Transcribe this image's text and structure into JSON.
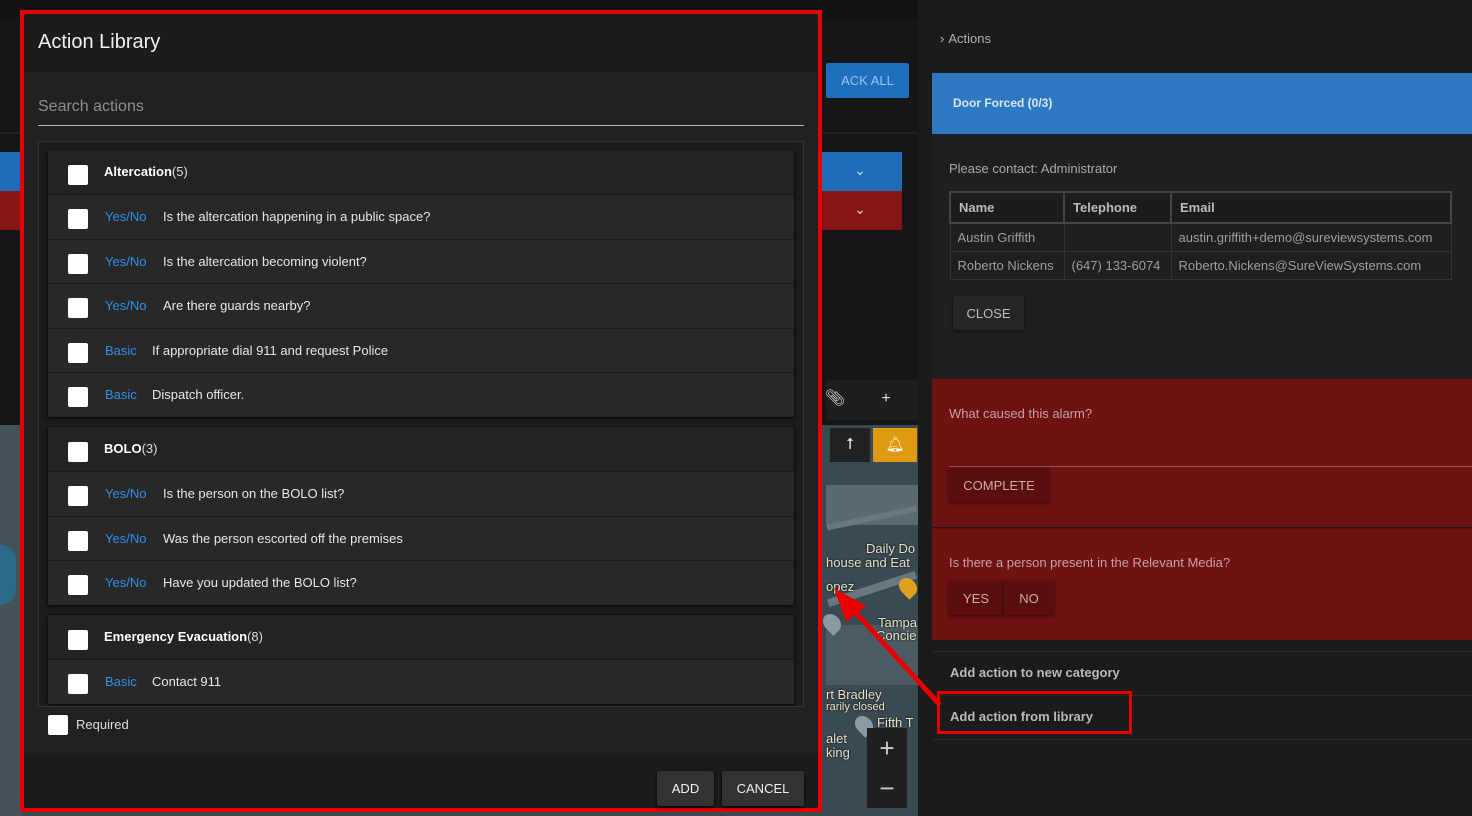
{
  "background": {
    "ack_all": "ACK ALL",
    "map_labels": [
      "Daily Do",
      "house and Eat",
      "opez",
      "Tampa",
      "Concie",
      "rt Bradley",
      "rarily closed",
      "Fifth T",
      "alet",
      "king"
    ]
  },
  "right_panel": {
    "breadcrumb": "Actions",
    "alarm_title": "Door Forced (0/3)",
    "contact_message": "Please contact: Administrator",
    "contacts_table": {
      "headers": [
        "Name",
        "Telephone",
        "Email"
      ],
      "rows": [
        [
          "Austin Griffith",
          "",
          "austin.griffith+demo@sureviewsystems.com"
        ],
        [
          "Roberto Nickens",
          "(647) 133-6074",
          "Roberto.Nickens@SureViewSystems.com"
        ]
      ]
    },
    "close_label": "CLOSE",
    "question_1": "What caused this alarm?",
    "complete_label": "COMPLETE",
    "question_2": "Is there a person present in the Relevant Media?",
    "yes_label": "YES",
    "no_label": "NO",
    "add_to_new_category": "Add action to new category",
    "add_from_library": "Add action from library"
  },
  "modal": {
    "title": "Action Library",
    "search_placeholder": "Search actions",
    "groups": [
      {
        "name": "Altercation",
        "count": "(5)",
        "items": [
          {
            "type": "Yes/No",
            "text": "Is the altercation happening in a public space?"
          },
          {
            "type": "Yes/No",
            "text": "Is the altercation becoming violent?"
          },
          {
            "type": "Yes/No",
            "text": "Are there guards nearby?"
          },
          {
            "type": "Basic",
            "text": "If appropriate dial 911 and request Police"
          },
          {
            "type": "Basic",
            "text": "Dispatch officer."
          }
        ]
      },
      {
        "name": "BOLO",
        "count": "(3)",
        "items": [
          {
            "type": "Yes/No",
            "text": "Is the person on the BOLO list?"
          },
          {
            "type": "Yes/No",
            "text": "Was the person escorted off the premises"
          },
          {
            "type": "Yes/No",
            "text": "Have you updated the BOLO list?"
          }
        ]
      },
      {
        "name": "Emergency Evacuation",
        "count": "(8)",
        "items": [
          {
            "type": "Basic",
            "text": "Contact 911"
          }
        ]
      }
    ],
    "required_label": "Required",
    "add_label": "ADD",
    "cancel_label": "CANCEL"
  },
  "colors": {
    "highlight": "#e80000",
    "type_link": "#2f8fe8",
    "alarm_blue": "#2e78c2",
    "alarm_red": "#6e1212"
  }
}
